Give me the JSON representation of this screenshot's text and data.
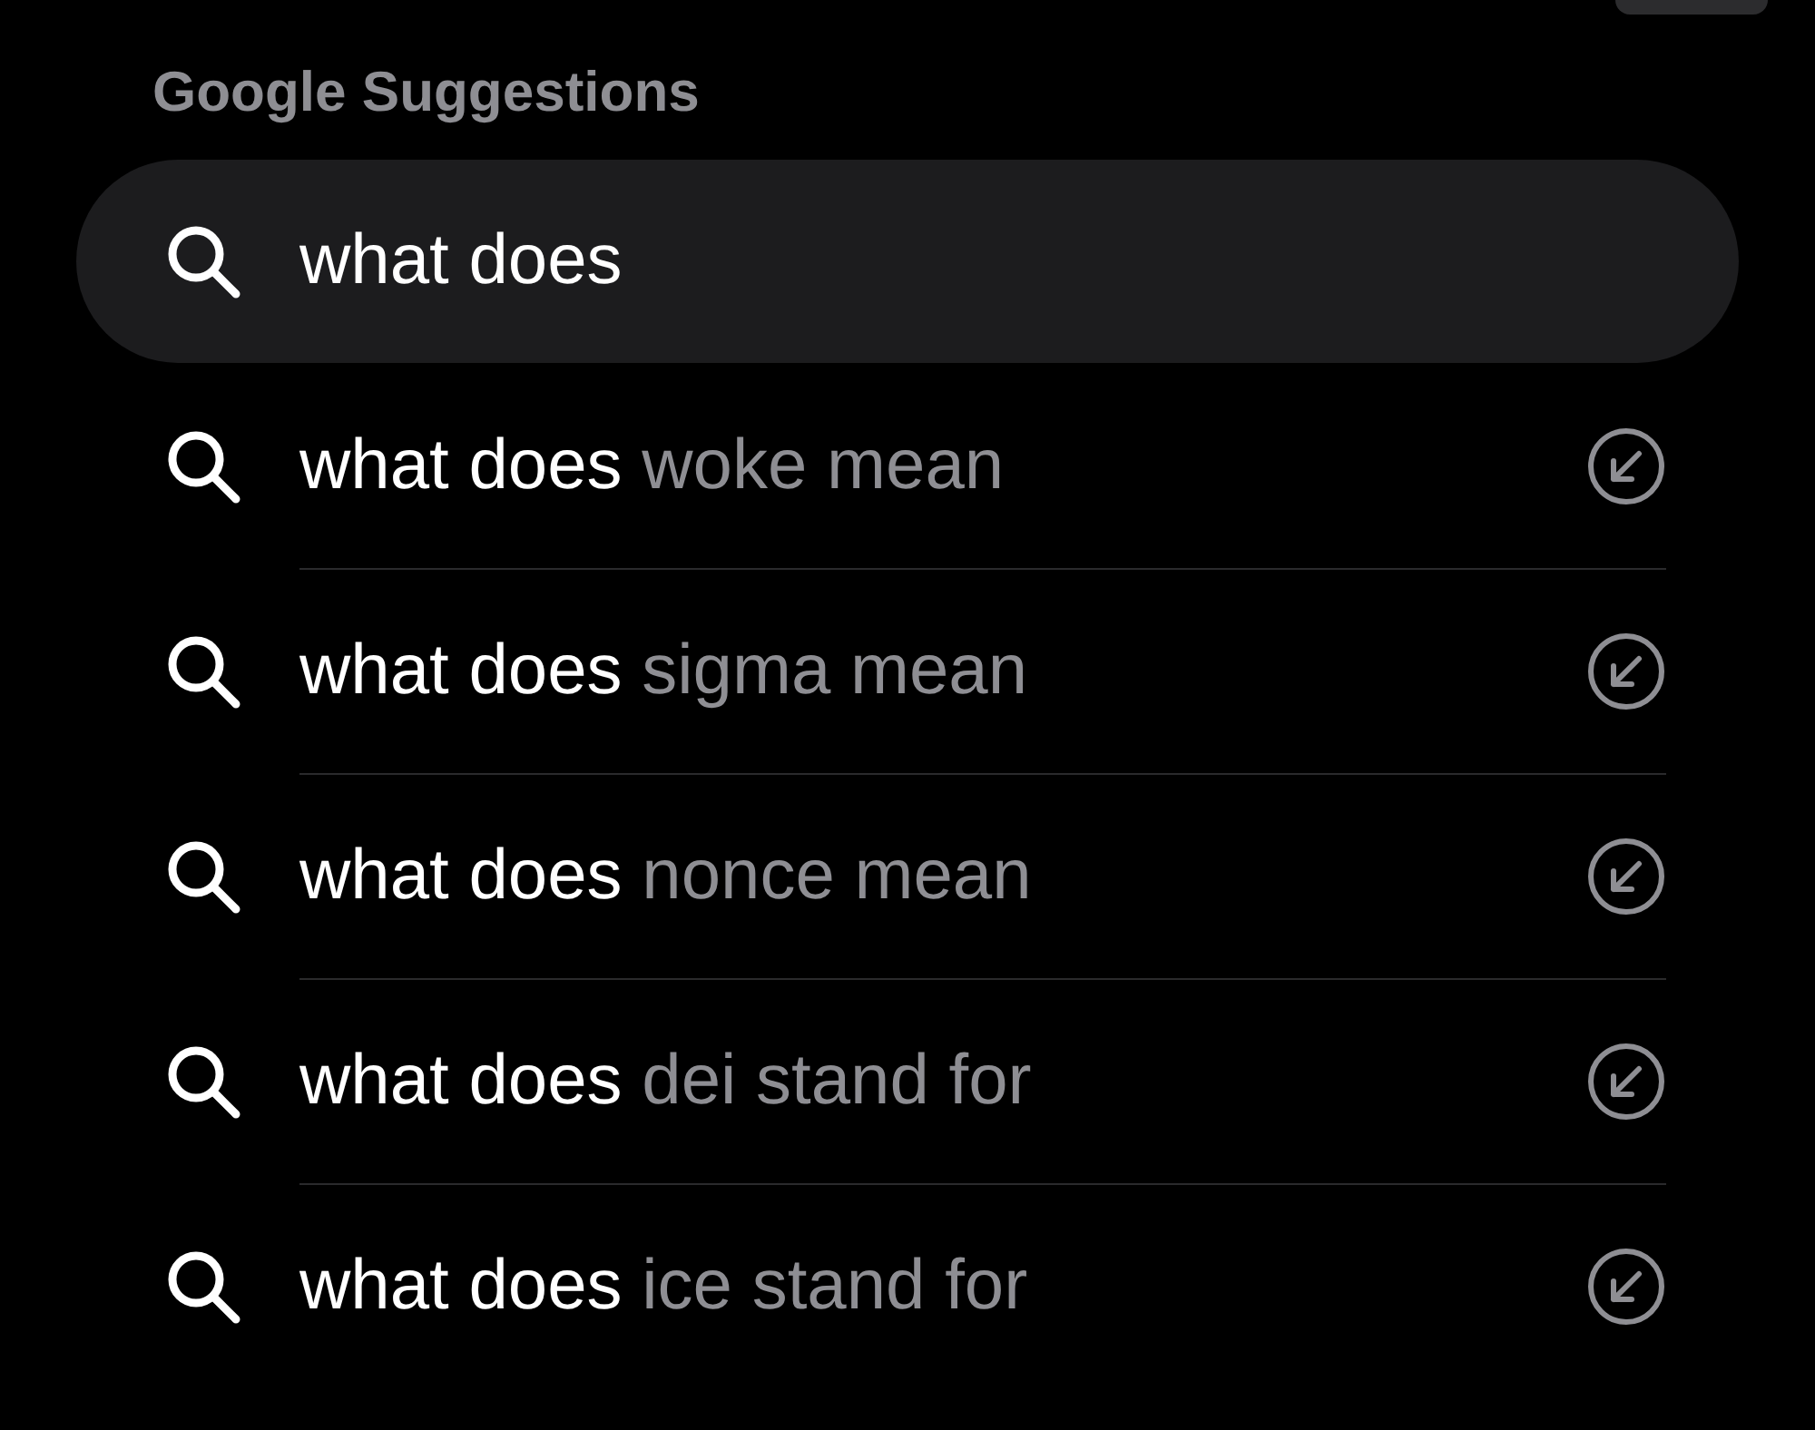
{
  "section_title": "Google Suggestions",
  "query": {
    "text": "what does"
  },
  "suggestions": [
    {
      "typed": "what does",
      "completion": "woke mean"
    },
    {
      "typed": "what does",
      "completion": "sigma mean"
    },
    {
      "typed": "what does",
      "completion": "nonce mean"
    },
    {
      "typed": "what does",
      "completion": "dei stand for"
    },
    {
      "typed": "what does",
      "completion": "ice stand for"
    }
  ]
}
